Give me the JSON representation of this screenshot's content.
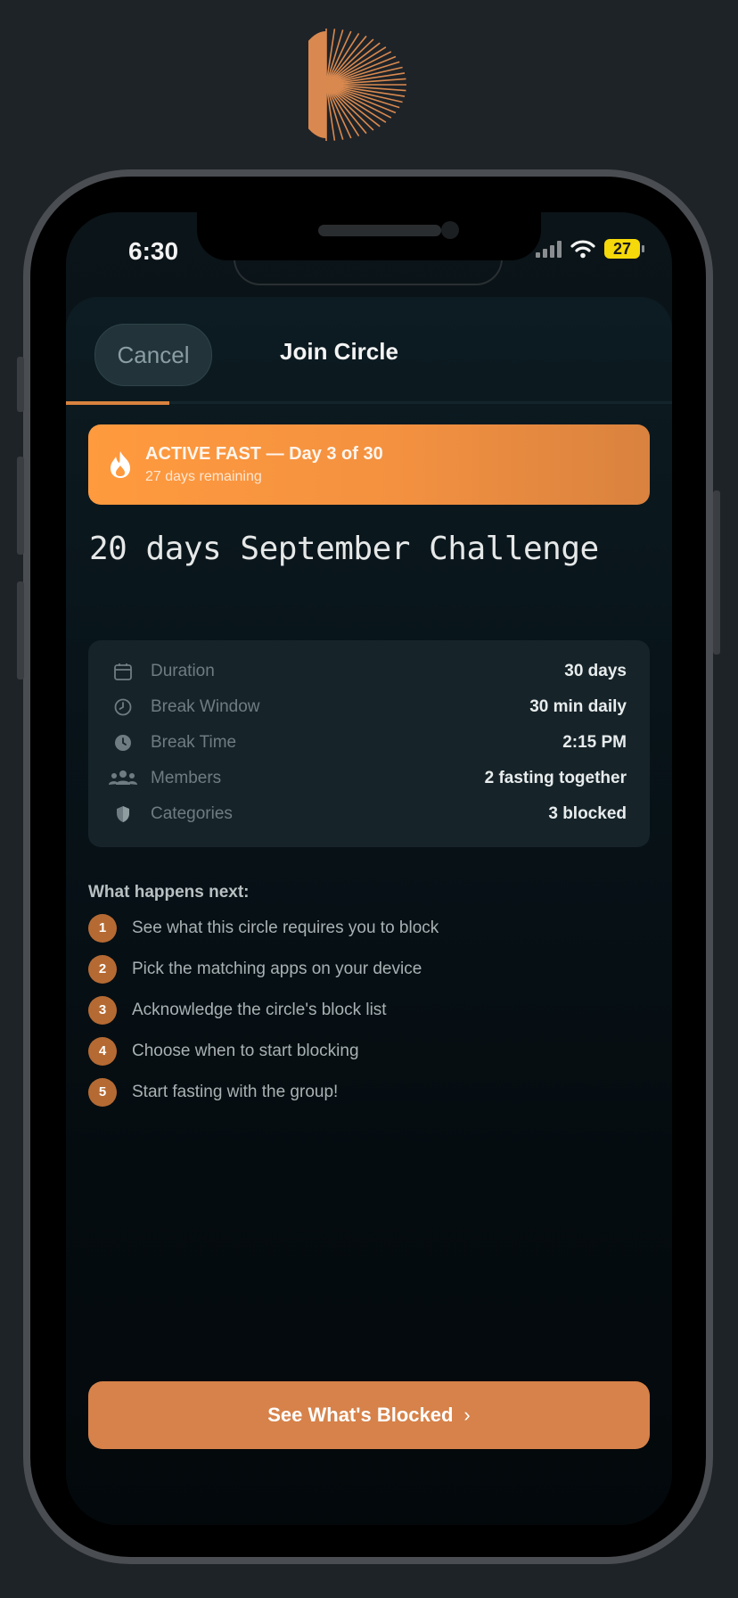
{
  "colors": {
    "background": "#1e2328",
    "accent": "#d9823f",
    "banner": "#ff9a3e",
    "battery": "#f5d90a"
  },
  "status_bar": {
    "time": "6:30",
    "battery": "27",
    "icons": [
      "cellular-signal-icon",
      "wifi-icon",
      "battery-icon"
    ]
  },
  "header": {
    "cancel_label": "Cancel",
    "title": "Join Circle",
    "step_progress": 0.17
  },
  "banner": {
    "icon": "flame-icon",
    "title": "ACTIVE FAST — Day 3 of 30",
    "subtitle": "27 days remaining"
  },
  "circle": {
    "name": "20 days September Challenge"
  },
  "details": [
    {
      "icon": "calendar-icon",
      "label": "Duration",
      "value": "30 days"
    },
    {
      "icon": "clock-icon",
      "label": "Break Window",
      "value": "30 min daily"
    },
    {
      "icon": "clock-filled-icon",
      "label": "Break Time",
      "value": "2:15 PM"
    },
    {
      "icon": "people-icon",
      "label": "Members",
      "value": "2 fasting together"
    },
    {
      "icon": "shield-icon",
      "label": "Categories",
      "value": "3 blocked"
    }
  ],
  "next_steps": {
    "title": "What happens next:",
    "items": [
      {
        "num": "1",
        "text": "See what this circle requires you to block"
      },
      {
        "num": "2",
        "text": "Pick the matching apps on your device"
      },
      {
        "num": "3",
        "text": "Acknowledge the circle's block list"
      },
      {
        "num": "4",
        "text": "Choose when to start blocking"
      },
      {
        "num": "5",
        "text": "Start fasting with the group!"
      }
    ]
  },
  "cta": {
    "label": "See What's Blocked",
    "icon": "chevron-right-icon"
  }
}
